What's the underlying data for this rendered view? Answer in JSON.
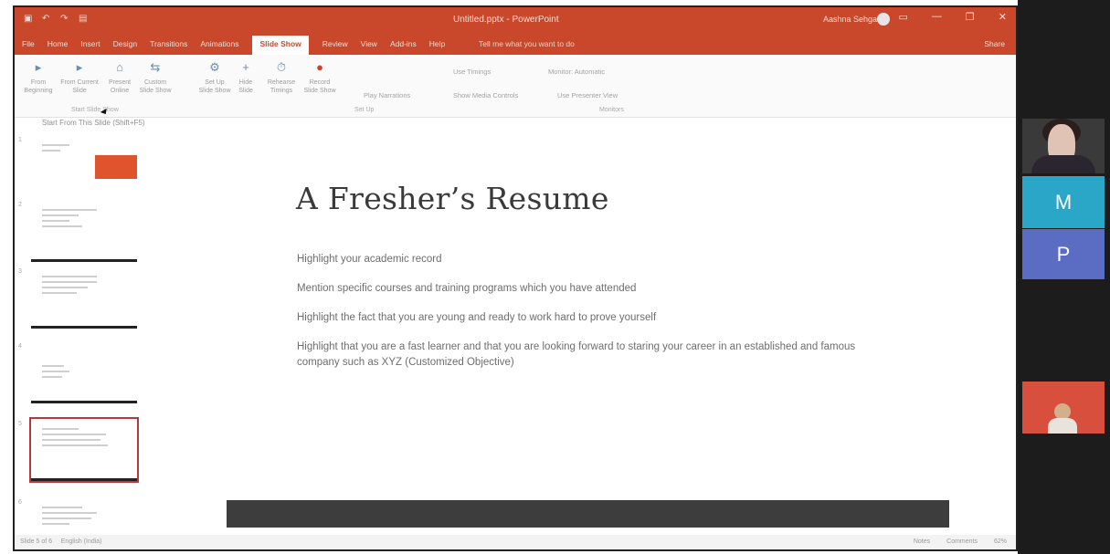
{
  "titlebar": {
    "doc_title": "Untitled.pptx - PowerPoint",
    "user": "Aashna Sehgal",
    "qat_icons": [
      "save-icon",
      "undo-icon",
      "redo-icon",
      "present-icon"
    ],
    "window_buttons": [
      "ribbon-options-icon",
      "minimize-icon",
      "restore-icon",
      "close-icon"
    ]
  },
  "tabs": {
    "items": [
      "File",
      "Home",
      "Insert",
      "Design",
      "Transitions",
      "Animations",
      "Slide Show",
      "Review",
      "View",
      "Add-ins",
      "Help"
    ],
    "active": "Slide Show",
    "tell_me": "Tell me what you want to do",
    "share": "Share"
  },
  "ribbon": {
    "buttons": [
      {
        "label": "From Beginning",
        "icon": "play-icon"
      },
      {
        "label": "From Current Slide",
        "icon": "play-current-icon"
      },
      {
        "label": "Present Online",
        "icon": "present-online-icon"
      },
      {
        "label": "Custom Slide Show",
        "icon": "custom-show-icon"
      },
      {
        "label": "Set Up Slide Show",
        "icon": "setup-icon"
      },
      {
        "label": "Hide Slide",
        "icon": "hide-slide-icon"
      },
      {
        "label": "Rehearse Timings",
        "icon": "rehearse-icon"
      },
      {
        "label": "Record Slide Show",
        "icon": "record-icon"
      }
    ],
    "group_start": "Start Slide Show",
    "group_setup": "Set Up",
    "group_monitors": "Monitors",
    "play_narrations": "Play Narrations",
    "use_timings": "Use Timings",
    "show_media_controls": "Show Media Controls",
    "monitor": "Monitor: Automatic",
    "presenter_view": "Use Presenter View",
    "tooltip": "Start From This Slide (Shift+F5)"
  },
  "thumbnails": [
    {
      "num": "1"
    },
    {
      "num": "2"
    },
    {
      "num": "3"
    },
    {
      "num": "4"
    },
    {
      "num": "5",
      "selected": true
    },
    {
      "num": "6"
    }
  ],
  "slide": {
    "title": "A Fresher’s Resume",
    "bullets": [
      "Highlight your academic record",
      "Mention specific courses and training programs which you have attended",
      "Highlight the fact that you are young and ready to work hard to prove yourself",
      "Highlight that you are a fast learner and that you are looking forward to staring your career in an established and famous company such as XYZ (Customized Objective)"
    ]
  },
  "statusbar": {
    "slide_info": "Slide 5 of 6",
    "language": "English (India)",
    "notes": "Notes",
    "comments": "Comments",
    "zoom": "62%"
  },
  "participants": [
    {
      "kind": "video",
      "name": "participant-woman"
    },
    {
      "kind": "letter",
      "letter": "M",
      "color": "#2aa6c6"
    },
    {
      "kind": "letter",
      "letter": "P",
      "color": "#5b6cc3"
    },
    {
      "kind": "video",
      "name": "participant-child"
    }
  ]
}
